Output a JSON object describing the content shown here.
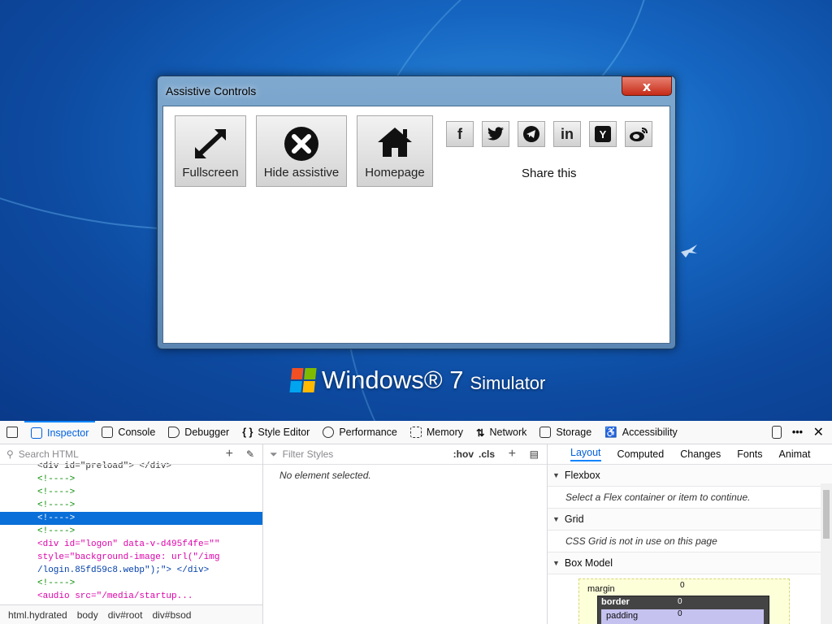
{
  "desktop": {
    "logo_text": "Windows® 7",
    "logo_sub": "Simulator"
  },
  "window": {
    "title": "Assistive Controls",
    "close_label": "x",
    "buttons": [
      {
        "label": "Fullscreen",
        "icon": "expand-arrows-icon"
      },
      {
        "label": "Hide assistive",
        "icon": "close-circle-icon"
      },
      {
        "label": "Homepage",
        "icon": "home-icon"
      }
    ],
    "social": [
      {
        "label": "f",
        "icon": "facebook-icon"
      },
      {
        "label": "",
        "icon": "twitter-icon"
      },
      {
        "label": "",
        "icon": "telegram-icon"
      },
      {
        "label": "in",
        "icon": "linkedin-icon"
      },
      {
        "label": "Y",
        "icon": "ycombinator-icon"
      },
      {
        "label": "",
        "icon": "weibo-icon"
      }
    ],
    "share_text": "Share this"
  },
  "devtools": {
    "tabs": [
      "Inspector",
      "Console",
      "Debugger",
      "Style Editor",
      "Performance",
      "Memory",
      "Network",
      "Storage",
      "Accessibility"
    ],
    "selected_tab": "Inspector",
    "search_html_placeholder": "Search HTML",
    "filter_styles_placeholder": "Filter Styles",
    "hov": ":hov",
    "cls": ".cls",
    "no_element": "No element selected.",
    "html_lines": [
      "<div id=\"preload\"> </div>",
      "<!---->",
      "<!---->",
      "<!---->",
      "<!---->",
      "<!---->",
      "<div id=\"logon\" data-v-d495f4fe=\"\"",
      "style=\"background-image: url(\"/img",
      "/login.85fd59c8.webp\");\"> </div>",
      "<!---->",
      "<audio src=\"/media/startup..."
    ],
    "breadcrumbs": [
      "html.hydrated",
      "body",
      "div#root",
      "div#bsod"
    ],
    "right_tabs": [
      "Layout",
      "Computed",
      "Changes",
      "Fonts",
      "Animat"
    ],
    "sections": [
      {
        "title": "Flexbox",
        "message": "Select a Flex container or item to continue."
      },
      {
        "title": "Grid",
        "message": "CSS Grid is not in use on this page"
      },
      {
        "title": "Box Model",
        "message": ""
      }
    ],
    "box_model": {
      "margin_label": "margin",
      "border_label": "border",
      "padding_label": "padding",
      "margin_top": "0",
      "border_top": "0",
      "padding_top": "0"
    }
  }
}
